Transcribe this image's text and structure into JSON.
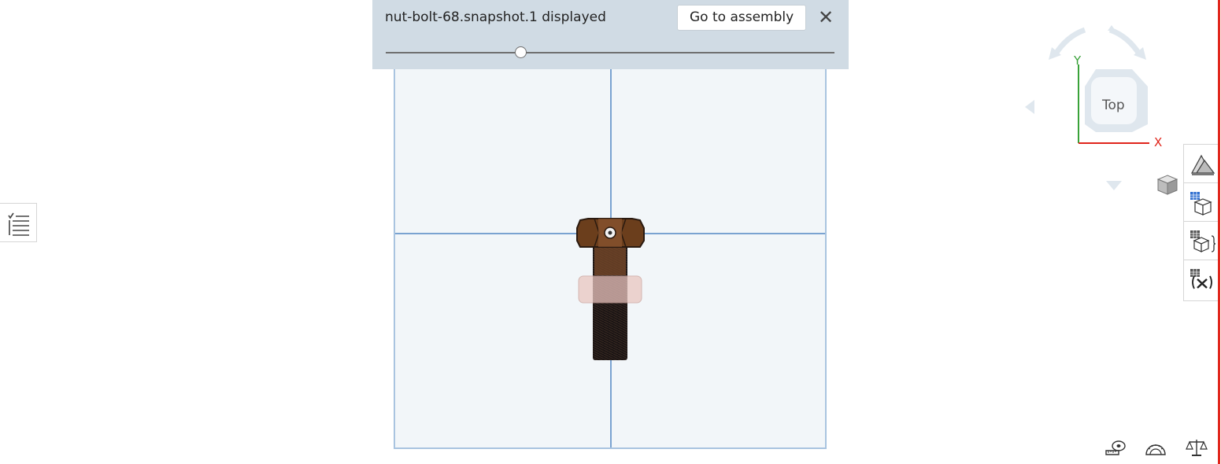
{
  "snapshot_bar": {
    "title": "nut-bolt-68.snapshot.1 displayed",
    "go_to_assembly_label": "Go to assembly",
    "close_glyph": "✕",
    "slider_position": 0.3
  },
  "view_cube": {
    "face_label": "Top",
    "y_axis_label": "Y",
    "x_axis_label": "X"
  },
  "colors": {
    "accent_red": "#e0251b",
    "axis_x": "#e0251b",
    "axis_y": "#3aa23a"
  },
  "icons": {
    "left": "list-icon",
    "view_mode": "cube-view-icon",
    "right_tools": [
      "appearance-icon",
      "configurations-icon",
      "properties-icon",
      "variables-icon"
    ],
    "bottom": [
      "measure-tape-icon",
      "protractor-icon",
      "mass-properties-icon"
    ]
  }
}
